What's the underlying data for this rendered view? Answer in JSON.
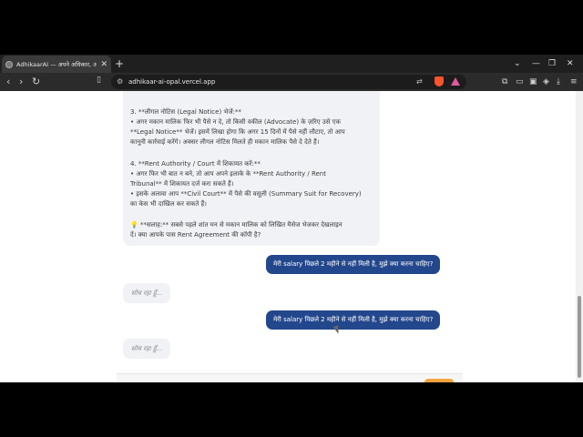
{
  "browser": {
    "tab_title": "AdhikaarAI — अपने अधिकार, अपनी",
    "tab_close": "✕",
    "new_tab": "+",
    "url": "adhikaar-ai-opal.vercel.app",
    "win_minimize": "—",
    "win_maximize": "❐",
    "win_close": "✕",
    "tabsearch": "⌄"
  },
  "bot_message": {
    "lines": [
      "3. **लीगल नोटिस (Legal Notice) भेजें:**",
      "   • अगर मकान मालिक फिर भी पैसे न दे, तो किसी वकील (Advocate) के ज़रिए उसे एक",
      "**Legal Notice** भेजें। इसमें लिखा होगा कि अगर 15 दिनों में पैसे नहीं लौटाए, तो आप",
      "कानूनी कार्रवाई करेंगे। अक्सर लीगल नोटिस मिलते ही मकान मालिक पैसे दे देते हैं।",
      "4. **Rent Authority / Court में शिकायत करें:**",
      "   • अगर फिर भी बात न बने, तो आप अपने इलाके के **Rent Authority / Rent",
      "Tribunal** में शिकायत दर्ज करा सकते हैं।",
      "   • इसके अलावा आप **Civil Court** में पैसे की वसूली (Summary Suit for Recovery)",
      "का केस भी दाखिल कर सकते हैं।",
      "💡 **सलाह:** सबसे पहले शांत मन से मकान मालिक को लिखित मैसेज भेजकर देखलाइन",
      "दें। क्या आपके पास Rent Agreement की कॉपी है?"
    ]
  },
  "messages": [
    {
      "role": "user",
      "text": "मेरी salary पिछले 2 महीने से नहीं मिली है, मुझे क्या करना चाहिए?"
    },
    {
      "role": "typing",
      "text": "सोच रहा हूँ..."
    },
    {
      "role": "user",
      "text": "मेरी salary पिछले 2 महीने से नहीं मिली है, मुझे क्या करना चाहिए?"
    },
    {
      "role": "typing",
      "text": "सोच रहा हूँ..."
    }
  ],
  "colors": {
    "user_bubble": "#23478c",
    "bot_bubble": "#f1f2f5",
    "send_button": "#f4a340"
  },
  "icons": [
    "back-icon",
    "forward-icon",
    "reload-icon",
    "bookmark-icon",
    "site-info-icon",
    "translate-icon",
    "share-icon",
    "brave-shield-icon",
    "brave-rewards-icon",
    "extensions-icon",
    "sidebar-icon",
    "wallet-icon",
    "vpn-icon",
    "download-icon",
    "menu-icon"
  ]
}
